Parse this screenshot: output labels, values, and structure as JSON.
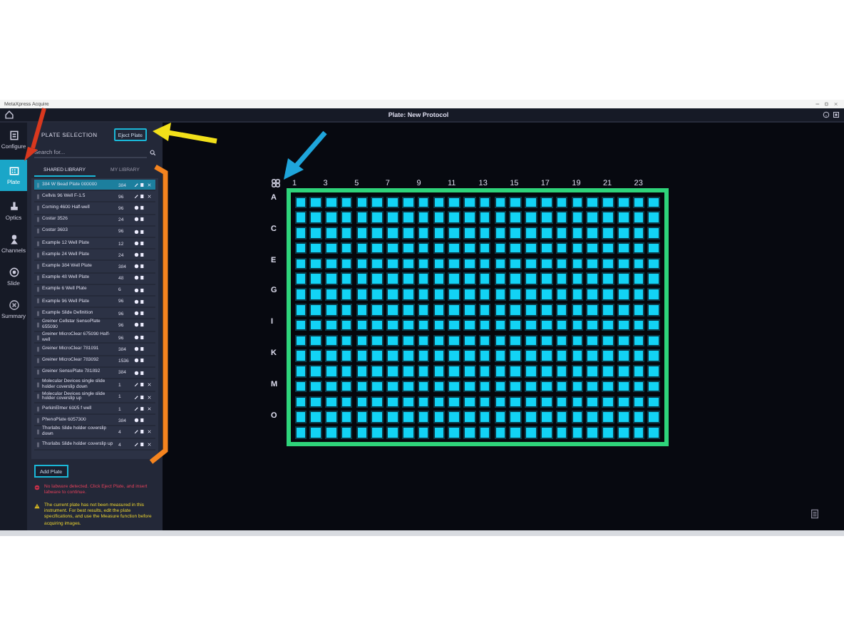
{
  "window": {
    "title": "MetaXpress Acquire"
  },
  "header": {
    "title": "Plate: New Protocol"
  },
  "nav": [
    {
      "label": "Configure",
      "selected": false,
      "kind": "configure"
    },
    {
      "label": "Plate",
      "selected": true,
      "kind": "plate"
    },
    {
      "label": "Optics",
      "selected": false,
      "kind": "optics"
    },
    {
      "label": "Channels",
      "selected": false,
      "kind": "channels"
    },
    {
      "label": "Slide",
      "selected": false,
      "kind": "slide"
    },
    {
      "label": "Summary",
      "selected": false,
      "kind": "summary"
    }
  ],
  "panel": {
    "title": "PLATE SELECTION",
    "eject_button": "Eject Plate",
    "search": {
      "placeholder": "Search for..."
    },
    "tabs": [
      {
        "label": "SHARED LIBRARY",
        "selected": true
      },
      {
        "label": "MY LIBRARY",
        "selected": false
      }
    ],
    "plates": [
      {
        "name": "384 W Bead Plate 000000",
        "count": "384",
        "selected": true,
        "kind": "custom"
      },
      {
        "name": "Cellvis 96 Well F-1.5",
        "count": "96",
        "selected": false,
        "kind": "custom"
      },
      {
        "name": "Corning 4600 Half-well",
        "count": "96",
        "selected": false,
        "kind": "builtin"
      },
      {
        "name": "Costar 3526",
        "count": "24",
        "selected": false,
        "kind": "builtin"
      },
      {
        "name": "Costar 3603",
        "count": "96",
        "selected": false,
        "kind": "builtin"
      },
      {
        "name": "Example 12 Well Plate",
        "count": "12",
        "selected": false,
        "kind": "builtin"
      },
      {
        "name": "Example 24 Well Plate",
        "count": "24",
        "selected": false,
        "kind": "builtin"
      },
      {
        "name": "Example 384 Well Plate",
        "count": "384",
        "selected": false,
        "kind": "builtin"
      },
      {
        "name": "Example 48 Well Plate",
        "count": "48",
        "selected": false,
        "kind": "builtin"
      },
      {
        "name": "Example 6 Well Plate",
        "count": "6",
        "selected": false,
        "kind": "builtin"
      },
      {
        "name": "Example 96 Well Plate",
        "count": "96",
        "selected": false,
        "kind": "builtin"
      },
      {
        "name": "Example Slide Definition",
        "count": "96",
        "selected": false,
        "kind": "builtin"
      },
      {
        "name": "Greiner Cellstar SensoPlate 655090",
        "count": "96",
        "selected": false,
        "kind": "builtin"
      },
      {
        "name": "Greiner MicroClear 675090 Half-well",
        "count": "96",
        "selected": false,
        "kind": "builtin"
      },
      {
        "name": "Greiner MicroClear 781091",
        "count": "384",
        "selected": false,
        "kind": "builtin"
      },
      {
        "name": "Greiner MicroClear 783092",
        "count": "1536",
        "selected": false,
        "kind": "builtin"
      },
      {
        "name": "Greiner SensoPlate 781892",
        "count": "384",
        "selected": false,
        "kind": "builtin"
      },
      {
        "name": "Molecular Devices single slide holder coverslip down",
        "count": "1",
        "selected": false,
        "kind": "custom"
      },
      {
        "name": "Molecular Devices single slide holder coverslip up",
        "count": "1",
        "selected": false,
        "kind": "custom"
      },
      {
        "name": "PerkinElmer 6005 f well",
        "count": "1",
        "selected": false,
        "kind": "custom"
      },
      {
        "name": "PhenoPlate 6057300",
        "count": "384",
        "selected": false,
        "kind": "builtin"
      },
      {
        "name": "Thorlabs Slide holder coverslip down",
        "count": "4",
        "selected": false,
        "kind": "custom"
      },
      {
        "name": "Thorlabs Slide holder coverslip up",
        "count": "4",
        "selected": false,
        "kind": "custom"
      }
    ],
    "add_button": "Add Plate",
    "messages": [
      {
        "kind": "error",
        "text": "No labware detected. Click Eject Plate, and insert labware to continue."
      },
      {
        "kind": "warning",
        "text": "The current plate has not been measured in this instrument. For best results, edit the plate specifications, and use the Measure function before acquiring images."
      }
    ]
  },
  "plate_map": {
    "column_labels": [
      "1",
      "3",
      "5",
      "7",
      "9",
      "11",
      "13",
      "15",
      "17",
      "19",
      "21",
      "23"
    ],
    "row_labels": [
      "A",
      "C",
      "E",
      "G",
      "I",
      "K",
      "M",
      "O"
    ]
  }
}
